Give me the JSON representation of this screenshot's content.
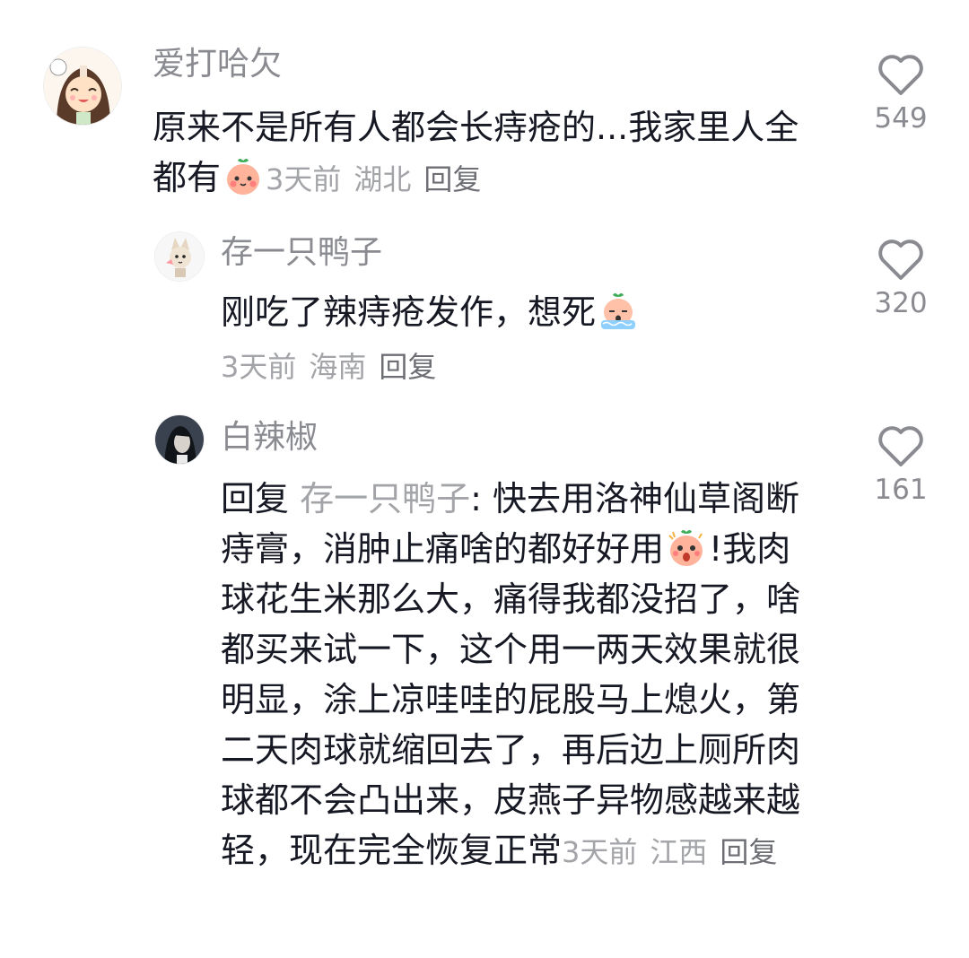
{
  "comments": [
    {
      "username": "爱打哈欠",
      "text": "原来不是所有人都会长痔疮的...我家里人全都有",
      "emoji": "blush-peach-emoji",
      "time": "3天前",
      "location": "湖北",
      "reply_label": "回复",
      "likes": "549"
    },
    {
      "username": "存一只鸭子",
      "text": "刚吃了辣痔疮发作，想死",
      "emoji": "crying-peach-emoji",
      "time": "3天前",
      "location": "海南",
      "reply_label": "回复",
      "likes": "320"
    },
    {
      "username": "白辣椒",
      "reply_prefix": "回复",
      "reply_target": "存一只鸭子",
      "text_part1": ": 快去用洛神仙草阁断痔膏，消肿止痛啥的都好好用",
      "emoji": "shocked-peach-emoji",
      "text_part2": "!我肉球花生米那么大，痛得我都没招了，啥都买来试一下，这个用一两天效果就很明显，涂上凉哇哇的屁股马上熄火，第二天肉球就缩回去了，再后边上厕所肉球都不会凸出来，皮燕子异物感越来越轻，现在完全恢复正常",
      "time": "3天前",
      "location": "江西",
      "reply_label": "回复",
      "likes": "161"
    }
  ],
  "colors": {
    "text": "#161823",
    "secondary": "#8a8b91",
    "meta": "#a3a4a8"
  }
}
